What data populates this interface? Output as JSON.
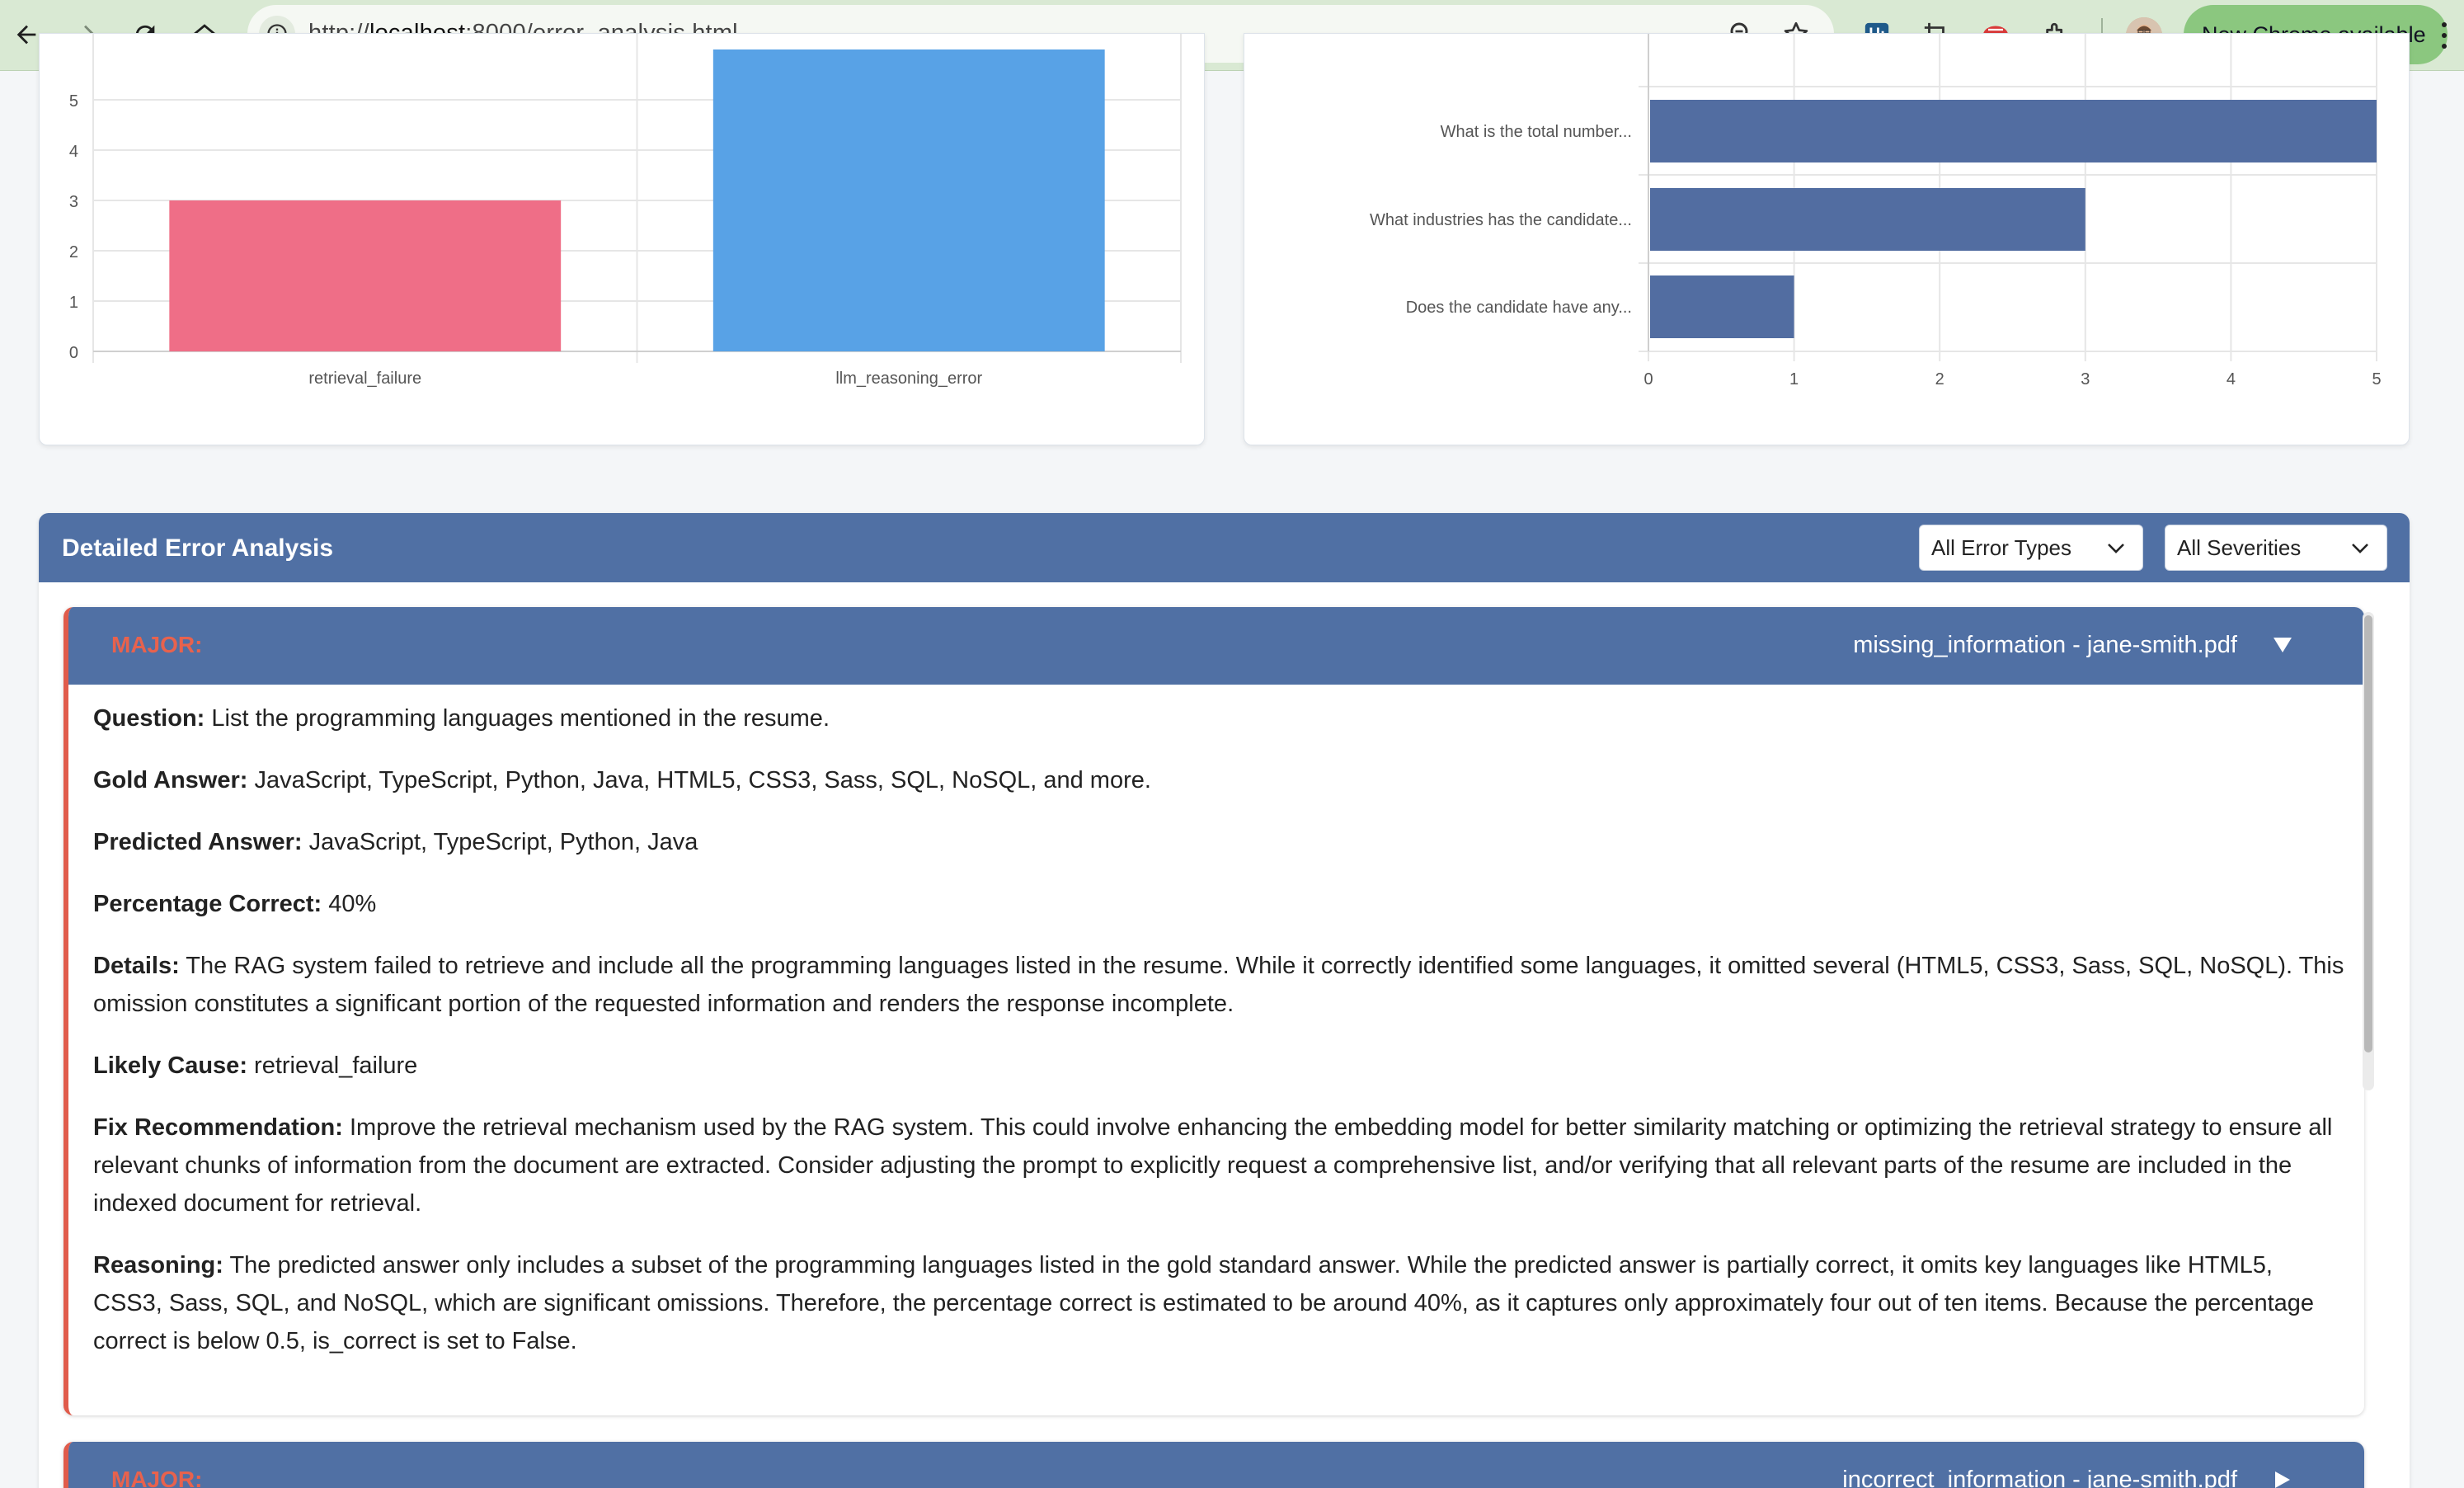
{
  "browser": {
    "url_prefix": "http://",
    "url_host": "localhost",
    "url_rest": ":8000/error_analysis.html",
    "update_label": "New Chrome available"
  },
  "chart_left": {
    "type": "bar",
    "categories": [
      "retrieval_failure",
      "llm_reasoning_error"
    ],
    "values": [
      3,
      6
    ],
    "y_ticks": [
      "0",
      "1",
      "2",
      "3",
      "4",
      "5"
    ],
    "colors": [
      "#ef6e87",
      "#58a2e6"
    ]
  },
  "chart_right": {
    "type": "bar",
    "orientation": "horizontal",
    "categories": [
      "What is the total number...",
      "What industries has the candidate...",
      "Does the candidate have any..."
    ],
    "values": [
      5,
      3,
      1
    ],
    "x_ticks": [
      "0",
      "1",
      "2",
      "3",
      "4",
      "5"
    ],
    "color": "#526da1"
  },
  "chart_data": [
    {
      "type": "bar",
      "categories": [
        "retrieval_failure",
        "llm_reasoning_error"
      ],
      "values": [
        3,
        6
      ],
      "ylim": [
        0,
        6
      ]
    },
    {
      "type": "bar",
      "orientation": "horizontal",
      "categories": [
        "What is the total number...",
        "What industries has the candidate...",
        "Does the candidate have any..."
      ],
      "values": [
        5,
        3,
        1
      ],
      "xlim": [
        0,
        5
      ]
    }
  ],
  "detail": {
    "title": "Detailed Error Analysis",
    "filter_type": "All Error Types",
    "filter_severity": "All Severities"
  },
  "errors": [
    {
      "severity": "MAJOR:",
      "title": "missing_information - jane-smith.pdf",
      "toggle": "▼",
      "question_label": "Question:",
      "question": " List the programming languages mentioned in the resume.",
      "gold_label": "Gold Answer:",
      "gold": " JavaScript, TypeScript, Python, Java, HTML5, CSS3, Sass, SQL, NoSQL, and more.",
      "pred_label": "Predicted Answer:",
      "pred": " JavaScript, TypeScript, Python, Java",
      "pct_label": "Percentage Correct:",
      "pct": " 40%",
      "details_label": "Details:",
      "details": " The RAG system failed to retrieve and include all the programming languages listed in the resume. While it correctly identified some languages, it omitted several (HTML5, CSS3, Sass, SQL, NoSQL). This omission constitutes a significant portion of the requested information and renders the response incomplete.",
      "cause_label": "Likely Cause:",
      "cause": " retrieval_failure",
      "fix_label": "Fix Recommendation:",
      "fix": " Improve the retrieval mechanism used by the RAG system. This could involve enhancing the embedding model for better similarity matching or optimizing the retrieval strategy to ensure all relevant chunks of information from the document are extracted. Consider adjusting the prompt to explicitly request a comprehensive list, and/or verifying that all relevant parts of the resume are included in the indexed document for retrieval.",
      "reason_label": "Reasoning:",
      "reason": " The predicted answer only includes a subset of the programming languages listed in the gold standard answer. While the predicted answer is partially correct, it omits key languages like HTML5, CSS3, Sass, SQL, and NoSQL, which are significant omissions. Therefore, the percentage correct is estimated to be around 40%, as it captures only approximately four out of ten items. Because the percentage correct is below 0.5, is_correct is set to False."
    },
    {
      "severity": "MAJOR:",
      "title": "incorrect_information - jane-smith.pdf",
      "toggle": "▶"
    }
  ]
}
